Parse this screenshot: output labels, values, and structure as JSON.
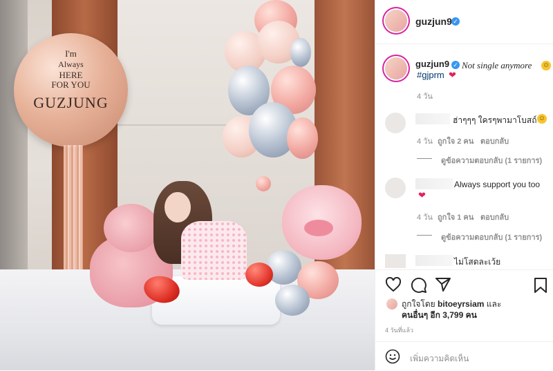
{
  "photo": {
    "balloon_lines": [
      "I'm",
      "Always",
      "HERE",
      "FOR YOU",
      "GUZJUNG"
    ]
  },
  "header": {
    "username": "guzjun9",
    "verified_mark": "✓"
  },
  "caption": {
    "username": "guzjun9",
    "text": "Not single anymore",
    "hashtag": "#gjprm",
    "time": "4 วัน"
  },
  "comments": [
    {
      "text": "ฮ่าๆๆๆ ใครๆพามาโบสถ์",
      "time": "4 วัน",
      "likes": "ถูกใจ 2 คน",
      "reply": "ตอบกลับ",
      "view_replies": "ดูข้อความตอบกลับ (1 รายการ)"
    },
    {
      "text": "Always support you too",
      "time": "4 วัน",
      "likes": "ถูกใจ 1 คน",
      "reply": "ตอบกลับ",
      "view_replies": "ดูข้อความตอบกลับ (1 รายการ)"
    },
    {
      "text": "ไม่โสดละเว้ย"
    }
  ],
  "actions": {
    "like_icon": "heart-outline-icon",
    "comment_icon": "comment-icon",
    "share_icon": "paper-plane-icon",
    "save_icon": "bookmark-icon"
  },
  "likes": {
    "line1_prefix": "ถูกใจโดย",
    "liker": "bitoeyrsiam",
    "line1_suffix": "และ",
    "others": "คนอื่นๆ อีก 3,799 คน"
  },
  "posted_time": "4 วันที่แล้ว",
  "add_comment": {
    "placeholder": "เพิ่มความคิดเห็น"
  },
  "colors": {
    "verified": "#3897f0",
    "hashtag": "#00376b",
    "muted": "#8e8e8e"
  }
}
